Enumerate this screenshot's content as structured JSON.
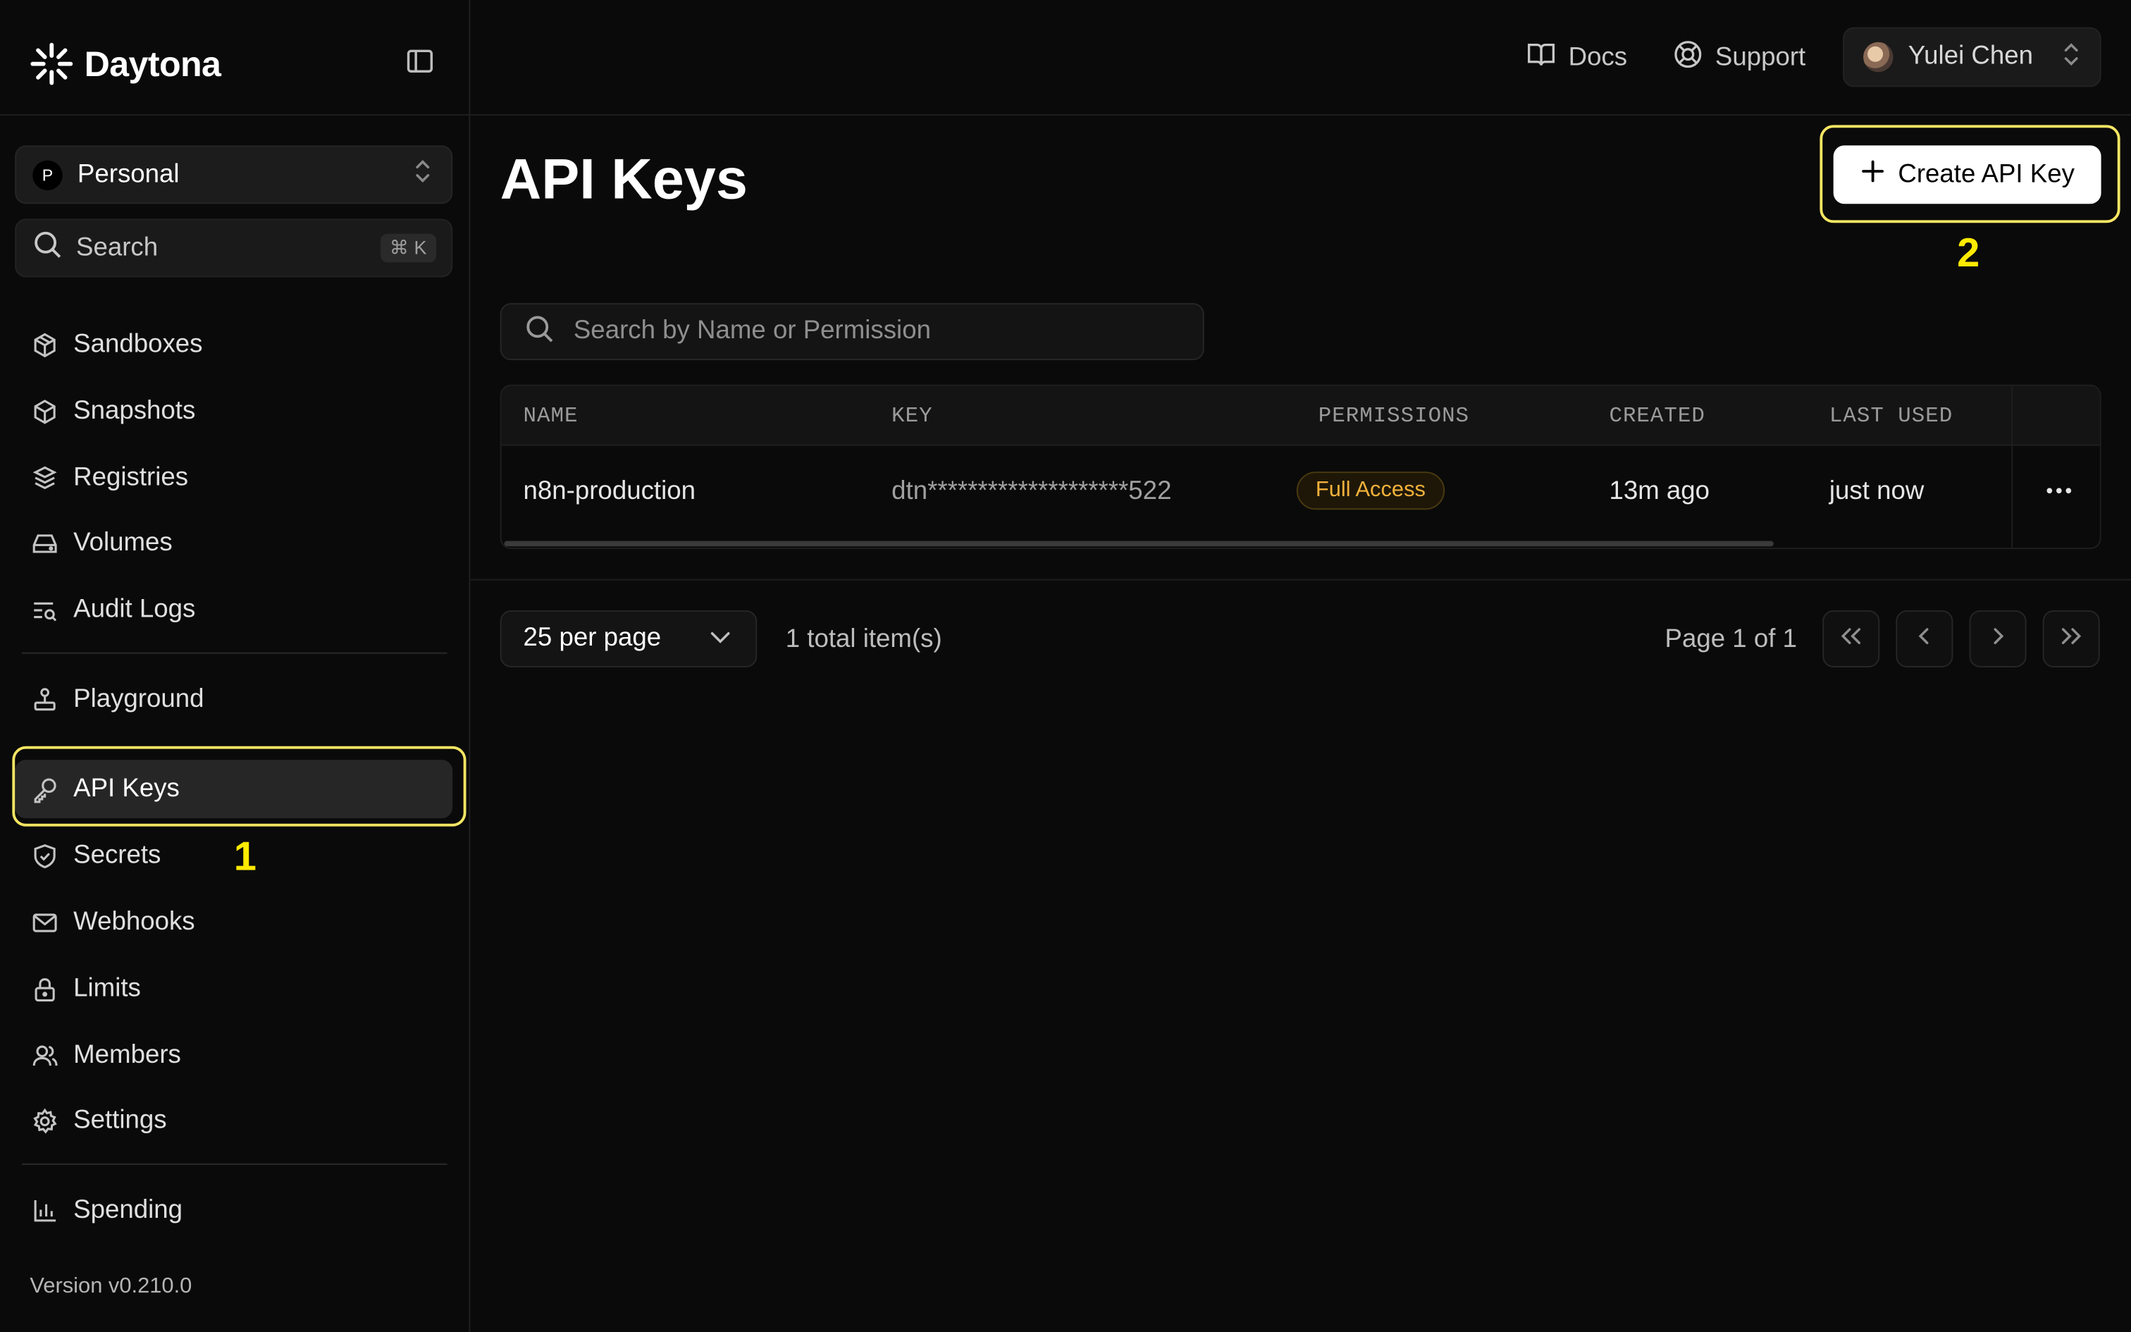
{
  "brand": {
    "name": "Daytona"
  },
  "org": {
    "initial": "P",
    "name": "Personal"
  },
  "search": {
    "label": "Search",
    "shortcut": "⌘ K"
  },
  "nav": {
    "items": [
      {
        "label": "Sandboxes",
        "icon": "box-icon"
      },
      {
        "label": "Snapshots",
        "icon": "cube-icon"
      },
      {
        "label": "Registries",
        "icon": "package-icon"
      },
      {
        "label": "Volumes",
        "icon": "hard-drive-icon"
      },
      {
        "label": "Audit Logs",
        "icon": "list-search-icon"
      },
      {
        "label": "Playground",
        "icon": "joystick-icon"
      },
      {
        "label": "API Keys",
        "icon": "key-icon",
        "active": true
      },
      {
        "label": "Secrets",
        "icon": "shield-icon"
      },
      {
        "label": "Webhooks",
        "icon": "mail-icon"
      },
      {
        "label": "Limits",
        "icon": "lock-icon"
      },
      {
        "label": "Members",
        "icon": "users-icon"
      },
      {
        "label": "Settings",
        "icon": "gear-icon"
      },
      {
        "label": "Spending",
        "icon": "bar-chart-icon"
      }
    ],
    "version": "Version v0.210.0"
  },
  "annotations": {
    "step1": "1",
    "step2": "2",
    "highlight_color": "#f5e663"
  },
  "topbar": {
    "docs": "Docs",
    "support": "Support",
    "user_name": "Yulei Chen"
  },
  "main": {
    "title": "API Keys",
    "create_button": "Create API Key",
    "search_placeholder": "Search by Name or Permission",
    "table": {
      "headers": [
        "NAME",
        "KEY",
        "PERMISSIONS",
        "CREATED",
        "LAST USED"
      ],
      "rows": [
        {
          "name": "n8n-production",
          "key": "dtn********************522",
          "permissions": "Full Access",
          "created": "13m ago",
          "last_used": "just now"
        }
      ]
    },
    "pagination": {
      "per_page": "25 per page",
      "total": "1 total item(s)",
      "page": "Page 1 of 1"
    }
  },
  "colors": {
    "background": "#0a0a0a",
    "accent_badge": "#f2b13b",
    "annotation": "#ffea00"
  }
}
